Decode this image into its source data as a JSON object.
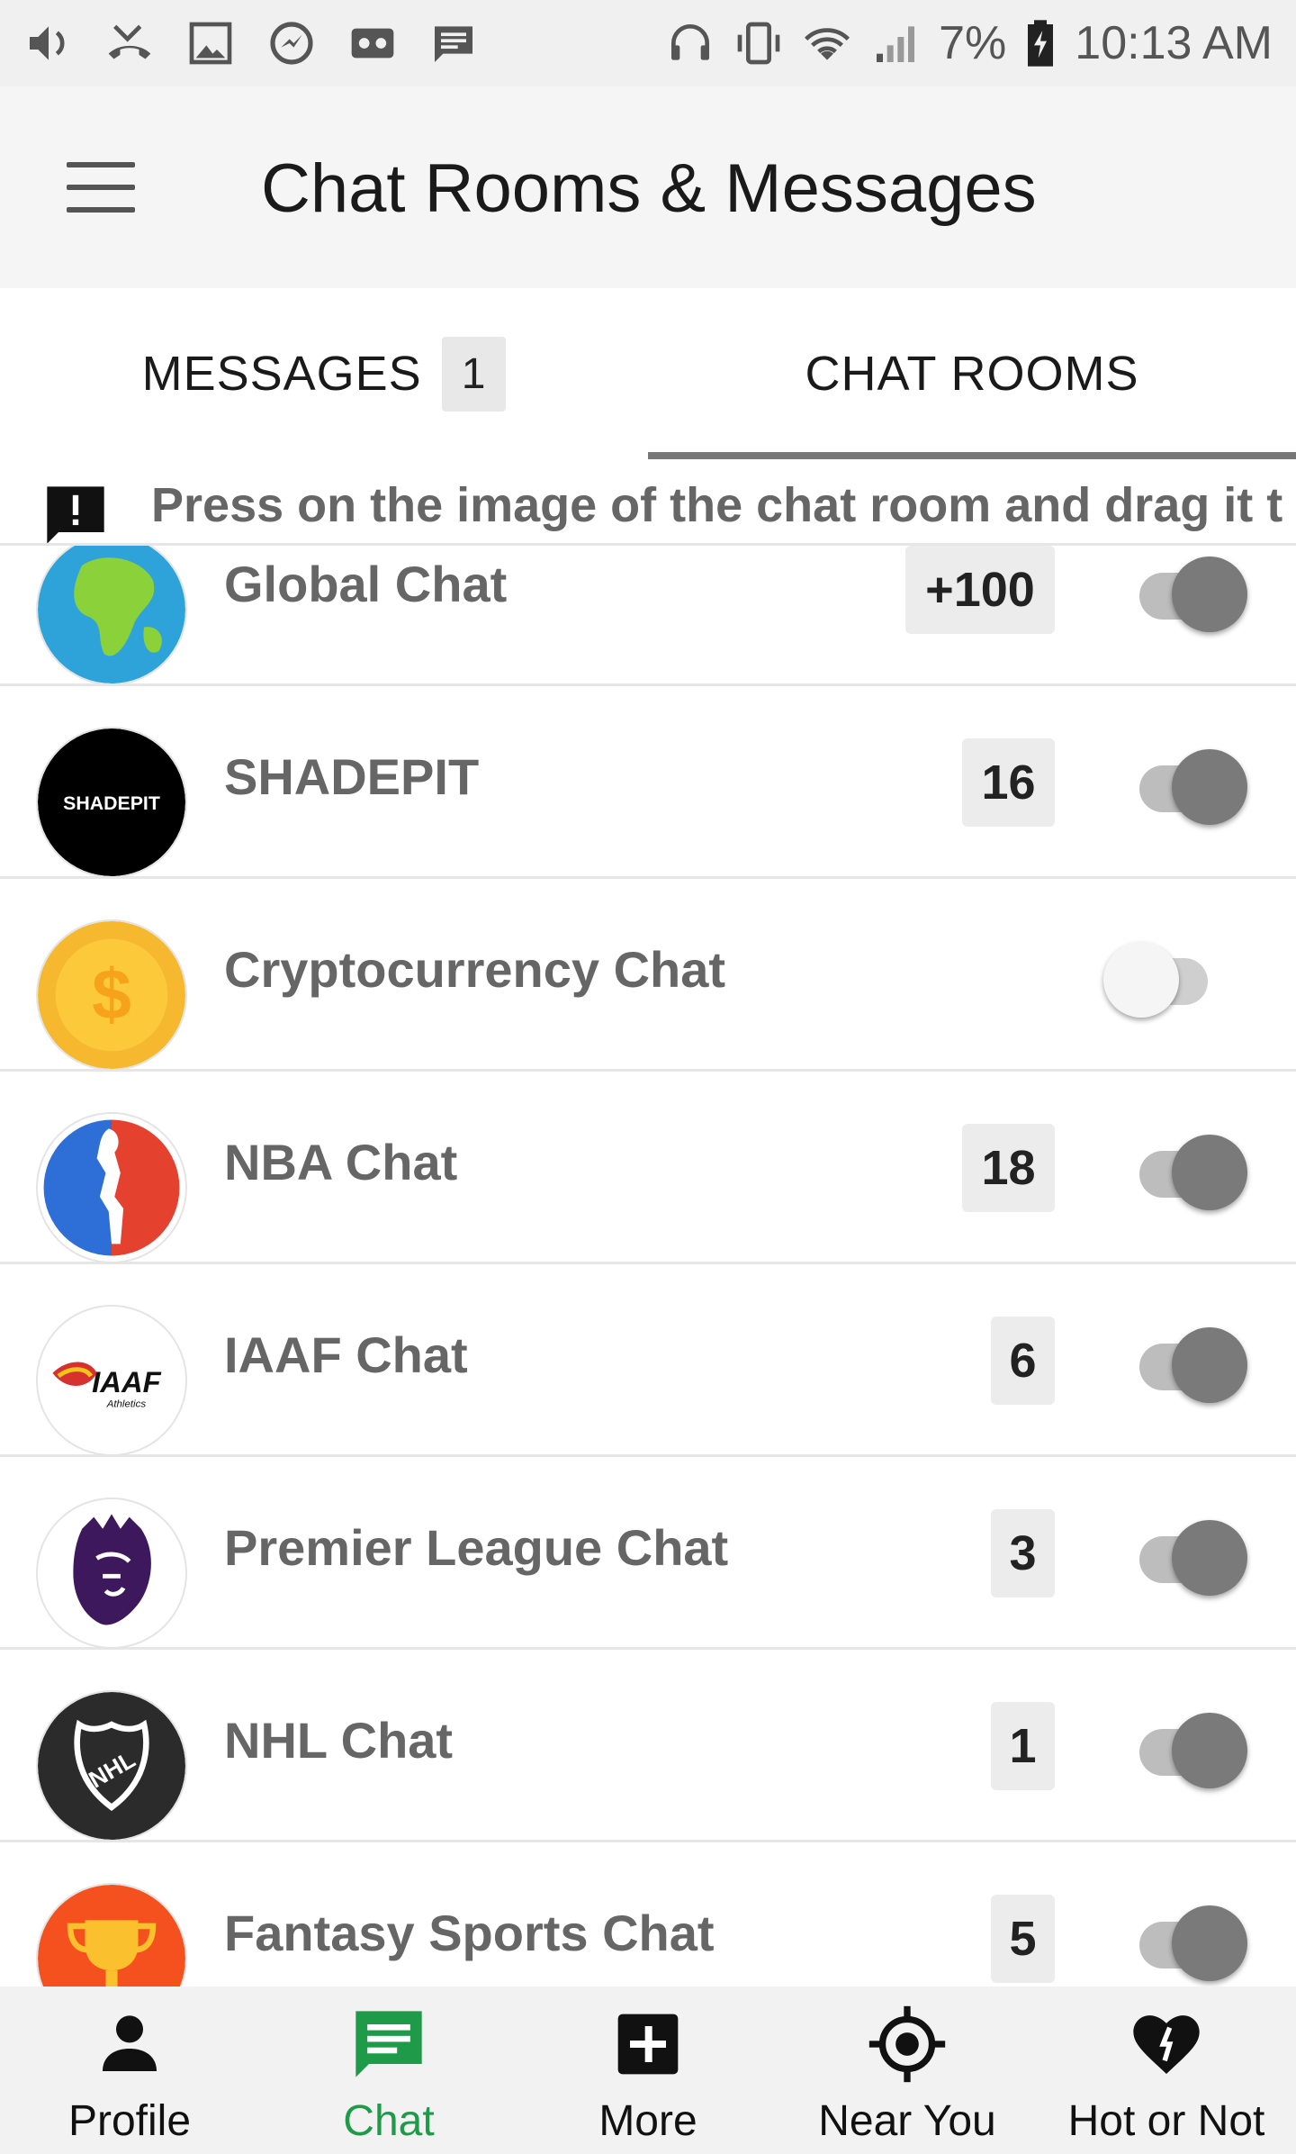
{
  "status_bar": {
    "battery_percent": "7%",
    "time": "10:13 AM",
    "left_icons": [
      "volume-icon",
      "missed-call-icon",
      "gallery-icon",
      "messenger-icon",
      "voicemail-icon",
      "message-icon"
    ],
    "right_icons": [
      "headset-icon",
      "vibrate-icon",
      "wifi-icon",
      "signal-icon",
      "battery-icon"
    ]
  },
  "app_bar": {
    "title": "Chat Rooms & Messages",
    "menu_icon": "hamburger-menu-icon"
  },
  "tabs": {
    "messages_label": "MESSAGES",
    "messages_badge": "1",
    "chat_rooms_label": "CHAT ROOMS",
    "selected": "chat_rooms"
  },
  "info_banner": {
    "icon": "feedback-alert-icon",
    "text": "Press on the image of the chat room and drag it t"
  },
  "rooms": [
    {
      "name": "Global Chat",
      "count": "+100",
      "enabled": true,
      "icon": "globe-icon"
    },
    {
      "name": "SHADEPIT",
      "count": "16",
      "enabled": true,
      "icon": "shadepit-logo",
      "logo_text": "SHADEPIT"
    },
    {
      "name": "Cryptocurrency Chat",
      "count": "",
      "enabled": false,
      "icon": "dollar-coin-icon",
      "logo_text": "$"
    },
    {
      "name": "NBA Chat",
      "count": "18",
      "enabled": true,
      "icon": "nba-logo"
    },
    {
      "name": "IAAF Chat",
      "count": "6",
      "enabled": true,
      "icon": "iaaf-logo",
      "logo_text": "IAAF",
      "logo_subtext": "Athletics"
    },
    {
      "name": "Premier League Chat",
      "count": "3",
      "enabled": true,
      "icon": "premier-league-lion-logo"
    },
    {
      "name": "NHL Chat",
      "count": "1",
      "enabled": true,
      "icon": "nhl-logo",
      "logo_text": "NHL"
    },
    {
      "name": "Fantasy Sports Chat",
      "count": "5",
      "enabled": true,
      "icon": "trophy-icon"
    }
  ],
  "bottom_nav": [
    {
      "label": "Profile",
      "icon": "person-icon",
      "active": false
    },
    {
      "label": "Chat",
      "icon": "chat-bubble-icon",
      "active": true
    },
    {
      "label": "More",
      "icon": "add-box-icon",
      "active": false
    },
    {
      "label": "Near You",
      "icon": "location-target-icon",
      "active": false
    },
    {
      "label": "Hot or Not",
      "icon": "heart-icon",
      "active": false
    }
  ],
  "colors": {
    "active_nav": "#1e9a48",
    "tab_indicator": "#777777",
    "app_bar_bg": "#f5f5f5"
  }
}
